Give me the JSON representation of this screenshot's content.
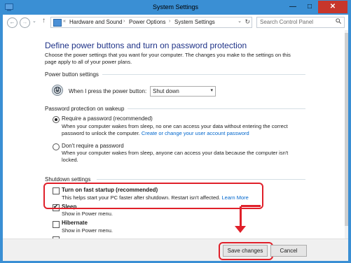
{
  "window": {
    "title": "System Settings",
    "minimize_glyph": "—",
    "maximize_glyph": "□",
    "close_glyph": "✕"
  },
  "nav": {
    "back_glyph": "←",
    "forward_glyph": "→",
    "recent_glyph": "⌄",
    "up_glyph": "↑",
    "breadcrumb": [
      "Hardware and Sound",
      "Power Options",
      "System Settings"
    ],
    "breadcrumb_prefix": "«",
    "breadcrumb_separator": "›",
    "dropdown_glyph": "⌄",
    "refresh_glyph": "↻",
    "search_placeholder": "Search Control Panel"
  },
  "page": {
    "title": "Define power buttons and turn on password protection",
    "intro": "Choose the power settings that you want for your computer. The changes you make to the settings on this page apply to all of your power plans."
  },
  "power_button": {
    "section": "Power button settings",
    "label": "When I press the power button:",
    "value": "Shut down",
    "dropdown_glyph": "▾"
  },
  "password": {
    "section": "Password protection on wakeup",
    "require_label": "Require a password (recommended)",
    "require_desc": "When your computer wakes from sleep, no one can access your data without entering the correct password to unlock the computer.",
    "require_link": "Create or change your user account password",
    "none_label": "Don't require a password",
    "none_desc": "When your computer wakes from sleep, anyone can access your data because the computer isn't locked."
  },
  "shutdown": {
    "section": "Shutdown settings",
    "fast_startup_label": "Turn on fast startup (recommended)",
    "fast_startup_desc": "This helps start your PC faster after shutdown. Restart isn't affected.",
    "fast_startup_link": "Learn More",
    "sleep_label": "Sleep",
    "sleep_desc": "Show in Power menu.",
    "hibernate_label": "Hibernate",
    "hibernate_desc": "Show in Power menu.",
    "fast_startup_checked": false,
    "sleep_checked": true,
    "hibernate_checked": false
  },
  "footer": {
    "save_label": "Save changes",
    "cancel_label": "Cancel"
  },
  "colors": {
    "titlebar": "#3a8fd4",
    "heading": "#1e3287",
    "link": "#0066cc",
    "highlight": "#e0202a",
    "close": "#c7362b"
  }
}
